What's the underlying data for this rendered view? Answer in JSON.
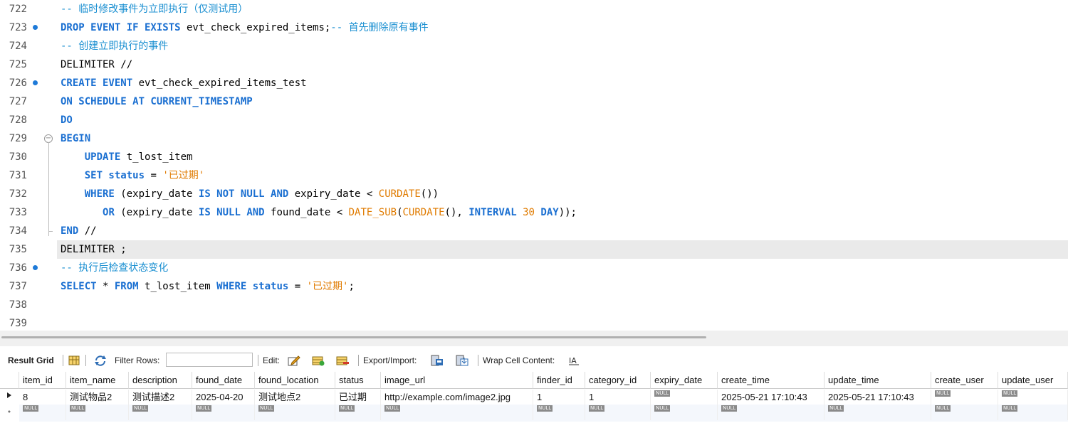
{
  "editor": {
    "lines": [
      {
        "num": "722",
        "tokens": [
          [
            "cm",
            "-- 临时修改事件为立即执行（仅测试用）"
          ]
        ]
      },
      {
        "num": "723",
        "mark": true,
        "tokens": [
          [
            "kw",
            "DROP EVENT IF EXISTS"
          ],
          [
            "tx",
            " evt_check_expired_items;"
          ],
          [
            "cm",
            "-- 首先删除原有事件"
          ]
        ]
      },
      {
        "num": "724",
        "tokens": [
          [
            "cm",
            "-- 创建立即执行的事件"
          ]
        ]
      },
      {
        "num": "725",
        "tokens": [
          [
            "tx",
            "DELIMITER //"
          ]
        ]
      },
      {
        "num": "726",
        "mark": true,
        "tokens": [
          [
            "kw",
            "CREATE EVENT"
          ],
          [
            "tx",
            " evt_check_expired_items_test"
          ]
        ]
      },
      {
        "num": "727",
        "tokens": [
          [
            "kw",
            "ON SCHEDULE AT CURRENT_TIMESTAMP"
          ]
        ]
      },
      {
        "num": "728",
        "tokens": [
          [
            "kw",
            "DO"
          ]
        ]
      },
      {
        "num": "729",
        "fold": true,
        "tokens": [
          [
            "kw",
            "BEGIN"
          ]
        ]
      },
      {
        "num": "730",
        "tokens": [
          [
            "tx",
            "    "
          ],
          [
            "kw",
            "UPDATE"
          ],
          [
            "tx",
            " t_lost_item"
          ]
        ]
      },
      {
        "num": "731",
        "tokens": [
          [
            "tx",
            "    "
          ],
          [
            "kw",
            "SET status"
          ],
          [
            "tx",
            " = "
          ],
          [
            "str",
            "'已过期'"
          ]
        ]
      },
      {
        "num": "732",
        "tokens": [
          [
            "tx",
            "    "
          ],
          [
            "kw",
            "WHERE"
          ],
          [
            "tx",
            " (expiry_date "
          ],
          [
            "kw",
            "IS NOT NULL AND"
          ],
          [
            "tx",
            " expiry_date < "
          ],
          [
            "str",
            "CURDATE"
          ],
          [
            "tx",
            "())"
          ]
        ]
      },
      {
        "num": "733",
        "tokens": [
          [
            "tx",
            "       "
          ],
          [
            "kw",
            "OR"
          ],
          [
            "tx",
            " (expiry_date "
          ],
          [
            "kw",
            "IS NULL AND"
          ],
          [
            "tx",
            " found_date < "
          ],
          [
            "str",
            "DATE_SUB"
          ],
          [
            "tx",
            "("
          ],
          [
            "str",
            "CURDATE"
          ],
          [
            "tx",
            "(), "
          ],
          [
            "kw",
            "INTERVAL"
          ],
          [
            "tx",
            " "
          ],
          [
            "num",
            "30"
          ],
          [
            "tx",
            " "
          ],
          [
            "kw",
            "DAY"
          ],
          [
            "tx",
            "));"
          ]
        ]
      },
      {
        "num": "734",
        "foldend": true,
        "tokens": [
          [
            "kw",
            "END"
          ],
          [
            "tx",
            " //"
          ]
        ]
      },
      {
        "num": "735",
        "hl": true,
        "tokens": [
          [
            "tx",
            "DELIMITER ;"
          ]
        ]
      },
      {
        "num": "736",
        "mark": true,
        "tokens": [
          [
            "cm",
            "-- 执行后检查状态变化"
          ]
        ]
      },
      {
        "num": "737",
        "tokens": [
          [
            "kw",
            "SELECT"
          ],
          [
            "tx",
            " * "
          ],
          [
            "kw",
            "FROM"
          ],
          [
            "tx",
            " t_lost_item "
          ],
          [
            "kw",
            "WHERE status"
          ],
          [
            "tx",
            " = "
          ],
          [
            "str",
            "'已过期'"
          ],
          [
            "tx",
            ";"
          ]
        ]
      },
      {
        "num": "738",
        "tokens": []
      },
      {
        "num": "739",
        "tokens": []
      }
    ]
  },
  "toolbar": {
    "result_grid": "Result Grid",
    "filter_rows": "Filter Rows:",
    "edit": "Edit:",
    "export_import": "Export/Import:",
    "wrap_cell": "Wrap Cell Content:"
  },
  "grid": {
    "columns": [
      "item_id",
      "item_name",
      "description",
      "found_date",
      "found_location",
      "status",
      "image_url",
      "finder_id",
      "category_id",
      "expiry_date",
      "create_time",
      "update_time",
      "create_user",
      "update_user"
    ],
    "row": [
      "8",
      "测试物品2",
      "测试描述2",
      "2025-04-20",
      "测试地点2",
      "已过期",
      "http://example.com/image2.jpg",
      "1",
      "1",
      "NULL",
      "2025-05-21 17:10:43",
      "2025-05-21 17:10:43",
      "NULL",
      "NULL"
    ],
    "null_label": "NULL"
  }
}
